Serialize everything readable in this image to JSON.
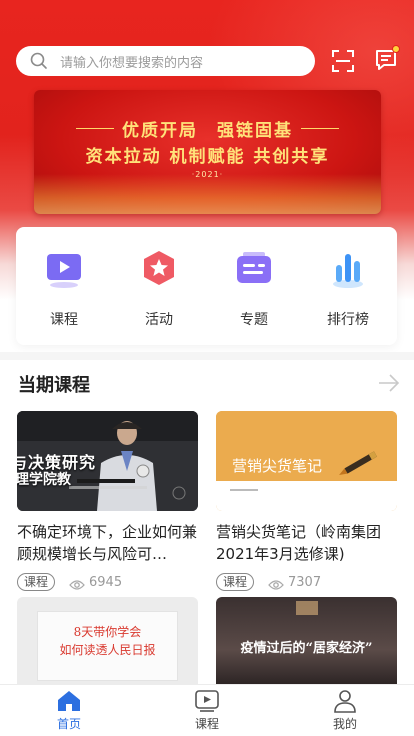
{
  "search": {
    "placeholder": "请输入你想要搜索的内容"
  },
  "header": {
    "scan_icon": "scan-icon",
    "message_icon": "message-icon",
    "has_unread": true
  },
  "banner": {
    "line1": "优质开局　强链固基",
    "line2": "资本拉动 机制赋能 共创共享",
    "year": "·2021·"
  },
  "quick_menu": [
    {
      "label": "课程",
      "icon": "play-screen-icon",
      "color": "#7b6bf3"
    },
    {
      "label": "活动",
      "icon": "star-badge-icon",
      "color": "#ef5a64"
    },
    {
      "label": "专题",
      "icon": "folder-list-icon",
      "color": "#8a6ff6"
    },
    {
      "label": "排行榜",
      "icon": "bar-ranking-icon",
      "color": "#5aaaf8"
    }
  ],
  "section": {
    "title": "当期课程"
  },
  "courses": [
    {
      "title": "不确定环境下，企业如何兼顾规模增长与风险可…",
      "tag": "课程",
      "views": "6945",
      "thumb_text": "与决策研究",
      "thumb_subtext": "理学院教"
    },
    {
      "title": "营销尖货笔记（岭南集团2021年3月选修课)",
      "tag": "课程",
      "views": "7307",
      "thumb_text": "营销尖货笔记"
    },
    {
      "title": "",
      "thumb_text": "8天带你学会",
      "thumb_text2": "如何读透人民日报"
    },
    {
      "title": "",
      "thumb_text": "疫情过后的“居家经济”"
    }
  ],
  "bottom_nav": [
    {
      "label": "首页",
      "icon": "home-icon",
      "active": true
    },
    {
      "label": "课程",
      "icon": "play-box-icon",
      "active": false
    },
    {
      "label": "我的",
      "icon": "user-icon",
      "active": false
    }
  ],
  "colors": {
    "brand_red": "#e2231d",
    "accent_blue": "#2c6fe0"
  }
}
